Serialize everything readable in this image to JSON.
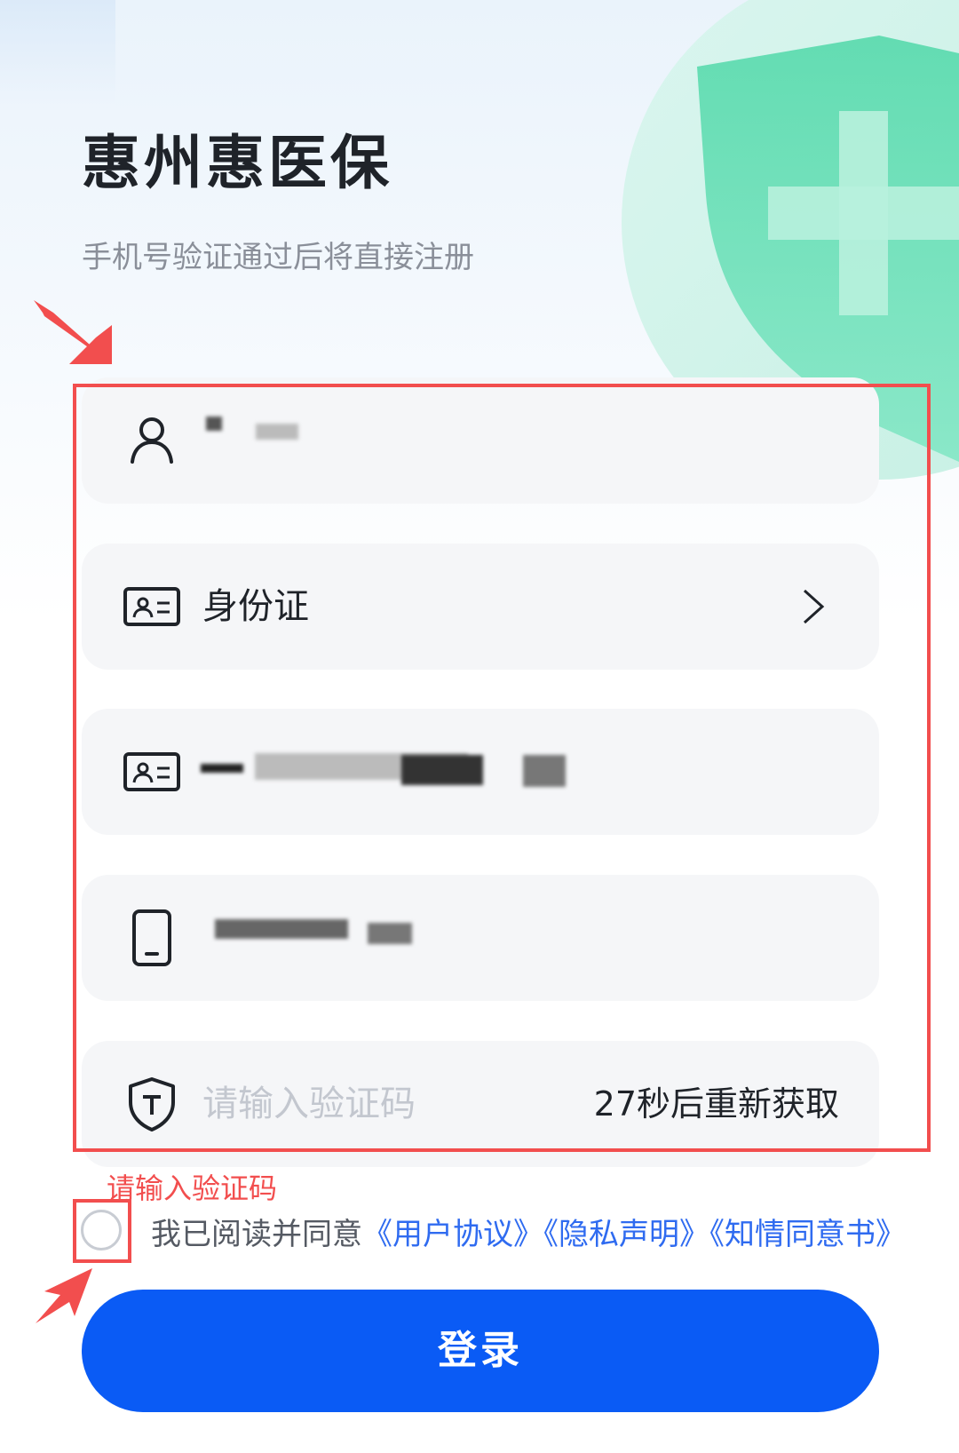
{
  "header": {
    "title": "惠州惠医保",
    "subtitle": "手机号验证通过后将直接注册"
  },
  "form": {
    "id_type": "身份证",
    "code_placeholder": "请输入验证码",
    "resend_label": "27秒后重新获取",
    "error_message": "请输入验证码"
  },
  "agreement": {
    "prefix": "我已阅读并同意",
    "user_agreement": "《用户协议》",
    "privacy": "《隐私声明》",
    "consent": "《知情同意书》"
  },
  "login_label": "登录",
  "colors": {
    "primary": "#0a5bf5",
    "link": "#2f6bf0",
    "error": "#f24e4e",
    "field_bg": "#f5f6f8"
  },
  "icons": [
    "user-icon",
    "id-card-icon",
    "phone-icon",
    "shield-t-icon",
    "chevron-right-icon"
  ]
}
